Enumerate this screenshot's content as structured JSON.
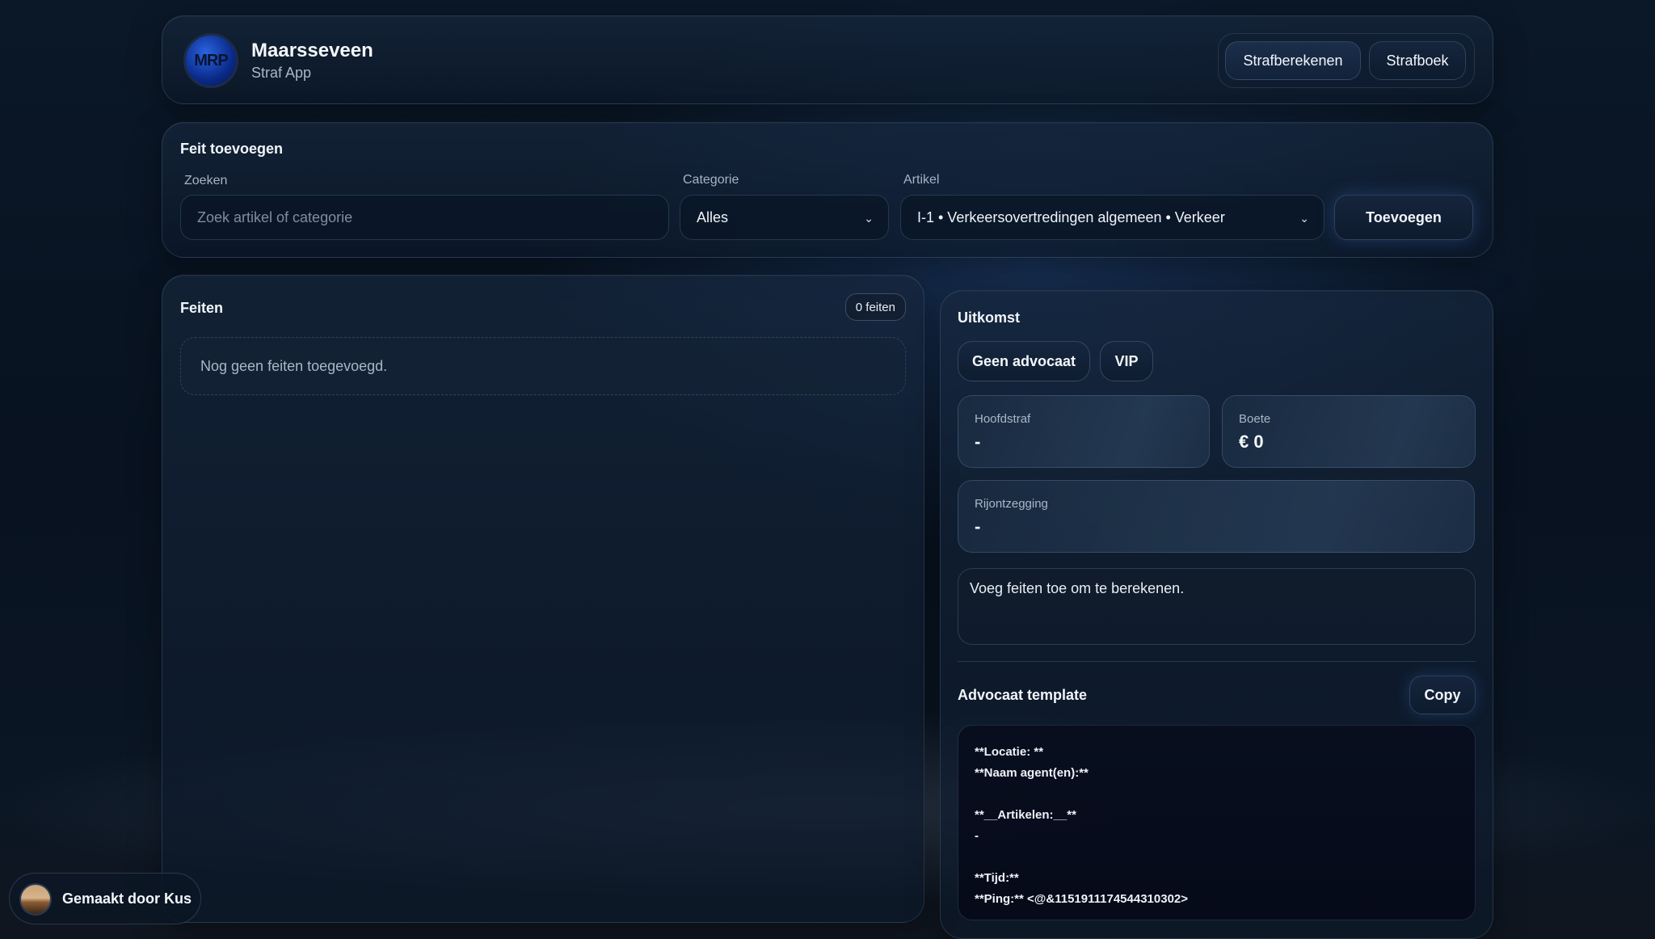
{
  "header": {
    "logo_text": "MRP",
    "app_name": "Maarsseveen",
    "app_subtitle": "Straf App",
    "nav": {
      "strafberekenen": "Strafberekenen",
      "strafboek": "Strafboek"
    }
  },
  "add_panel": {
    "title": "Feit toevoegen",
    "search_label": "Zoeken",
    "search_placeholder": "Zoek artikel of categorie",
    "category_label": "Categorie",
    "category_value": "Alles",
    "article_label": "Artikel",
    "article_value": "I-1 • Verkeersovertredingen algemeen • Verkeer",
    "add_button": "Toevoegen"
  },
  "feiten": {
    "title": "Feiten",
    "count_badge": "0 feiten",
    "empty_text": "Nog geen feiten toegevoegd."
  },
  "uitkomst": {
    "title": "Uitkomst",
    "toggle_lawyer": "Geen advocaat",
    "toggle_vip": "VIP",
    "hoofdstraf_label": "Hoofdstraf",
    "hoofdstraf_value": "-",
    "boete_label": "Boete",
    "boete_value": "€ 0",
    "rijontzegging_label": "Rijontzegging",
    "rijontzegging_value": "-",
    "note": "Voeg feiten toe om te berekenen.",
    "template_title": "Advocaat template",
    "copy_button": "Copy",
    "template_lines": [
      "**Locatie: **",
      "**Naam agent(en):**",
      "",
      "**__Artikelen:__**",
      "-",
      "",
      "**Tijd:**",
      "**Ping:** <@&1151911174544310302>"
    ]
  },
  "credit": {
    "text": "Gemaakt door Kus"
  }
}
